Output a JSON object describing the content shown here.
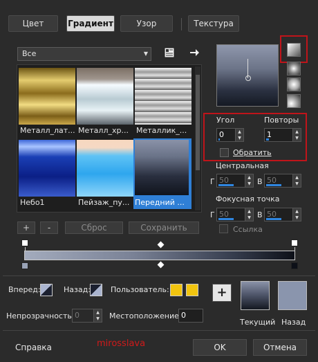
{
  "tabs": [
    {
      "label": "Цвет",
      "active": false
    },
    {
      "label": "Градиент",
      "active": true
    },
    {
      "label": "Узор",
      "active": false
    },
    {
      "label": "Текстура",
      "active": false
    }
  ],
  "category": {
    "value": "Все"
  },
  "gradients": [
    {
      "label": "Металл_лат...",
      "selected": false
    },
    {
      "label": "Металл_хр...",
      "selected": false
    },
    {
      "label": "Металлик_...",
      "selected": false
    },
    {
      "label": "Небо1",
      "selected": false
    },
    {
      "label": "Пейзаж_пу...",
      "selected": false
    },
    {
      "label": "Передний ...",
      "selected": true
    }
  ],
  "list_buttons": {
    "add": "+",
    "remove": "-",
    "reset": "Сброс",
    "save": "Сохранить"
  },
  "angle": {
    "label": "Угол",
    "value": "0"
  },
  "repeats": {
    "label": "Повторы",
    "value": "1"
  },
  "invert": {
    "label": "Обратить",
    "checked": false
  },
  "center": {
    "title": "Центральная",
    "h_label": "Г",
    "h_value": "50",
    "v_label": "В",
    "v_value": "50"
  },
  "focal": {
    "title": "Фокусная точка",
    "h_label": "Г",
    "h_value": "50",
    "v_label": "В",
    "v_value": "50"
  },
  "link": {
    "label": "Ссылка",
    "checked": false
  },
  "stops": {
    "forward_label": "Вперед:",
    "back_label": "Назад:",
    "user_label": "Пользователь:",
    "opacity_label": "Непрозрачность:",
    "opacity_value": "0",
    "position_label": "Местоположение:",
    "position_value": "0",
    "add_button": "+"
  },
  "preview": {
    "current_label": "Текущий",
    "back_label": "Назад"
  },
  "footer": {
    "help": "Справка",
    "watermark": "mirosslava",
    "ok": "OK",
    "cancel": "Отмена"
  },
  "colors": {
    "accent": "#2f7fd6",
    "highlight_box": "#c0141a",
    "user_swatch": "#f1c40f",
    "back_swatch": "#8a95ad"
  }
}
